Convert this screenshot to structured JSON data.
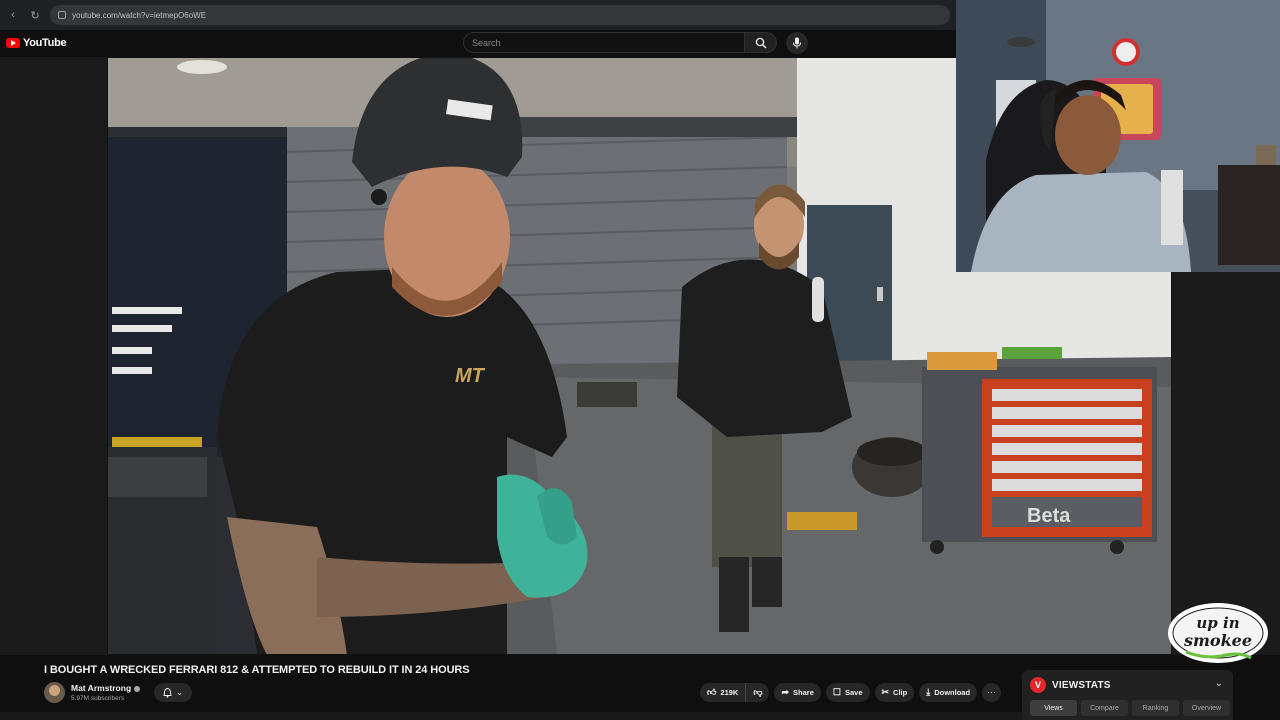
{
  "browser": {
    "url": "youtube.com/watch?v=ietmepO6oWE"
  },
  "header": {
    "logo_text": "YouTube",
    "search_placeholder": "Search"
  },
  "video": {
    "title": "I BOUGHT A WRECKED FERRARI 812 & ATTEMPTED TO REBUILD IT IN 24 HOURS",
    "toolbox_brand": "Beta",
    "shirt_logo": "MT"
  },
  "channel": {
    "name": "Mat Armstrong",
    "subscribers": "5.97M subscribers"
  },
  "actions": {
    "likes": "219K",
    "share": "Share",
    "save": "Save",
    "clip": "Clip",
    "download": "Download"
  },
  "viewstats": {
    "title": "VIEWSTATS",
    "tabs": [
      "Views",
      "Compare",
      "Ranking",
      "Overview"
    ],
    "active_tab": "Views"
  },
  "overlay": {
    "sticker_text_1": "up in",
    "sticker_text_2": "smokee"
  },
  "colors": {
    "accent": "#ff0000",
    "background": "#0f0f0f",
    "glove": "#3fb39a",
    "toolbox_red": "#c8401e"
  }
}
